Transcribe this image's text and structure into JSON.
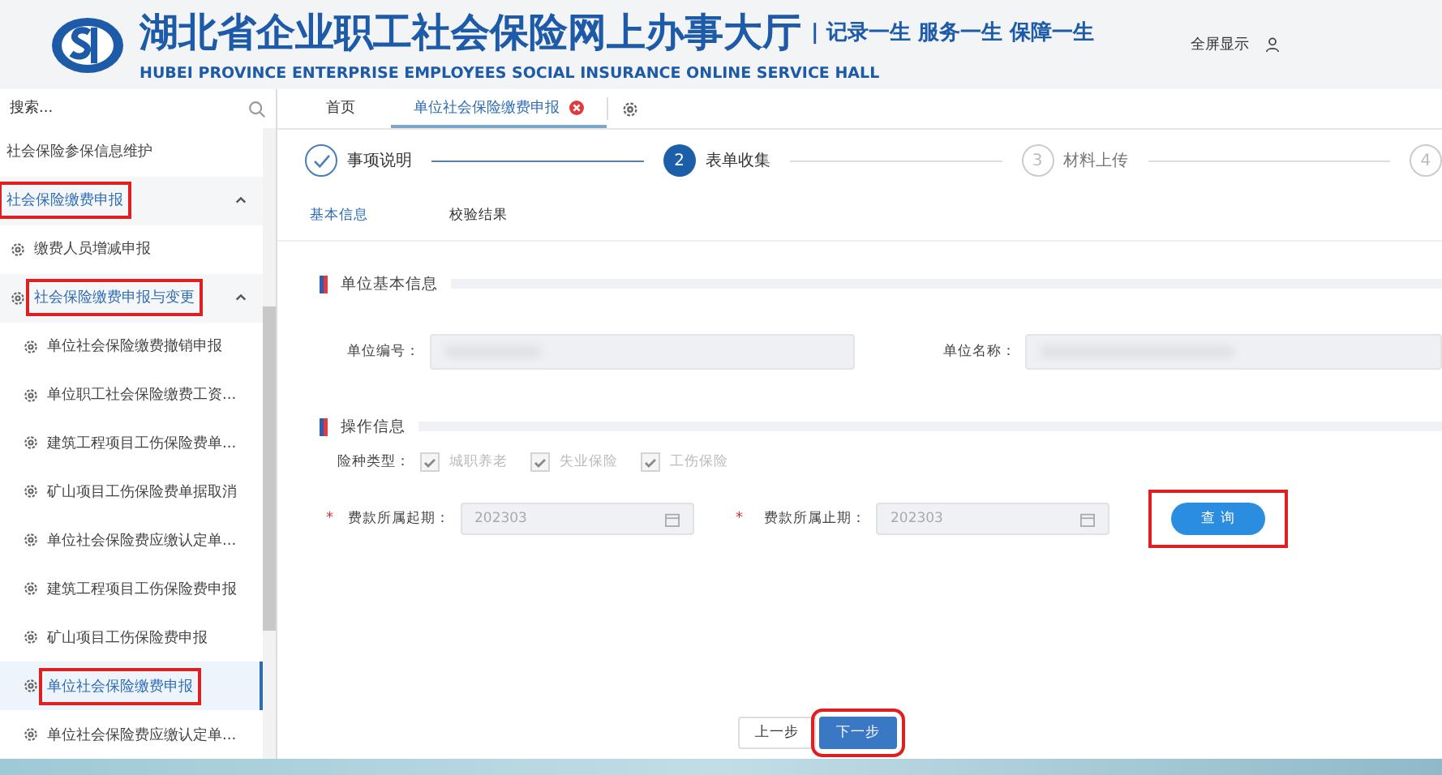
{
  "header": {
    "title": "湖北省企业职工社会保险网上办事大厅",
    "subtitle": "HUBEI PROVINCE ENTERPRISE EMPLOYEES SOCIAL INSURANCE ONLINE SERVICE HALL",
    "slogan": "| 记录一生  服务一生  保障一生",
    "fullscreen": "全屏显示"
  },
  "sidebar": {
    "search": {
      "placeholder": "搜索..."
    },
    "items": [
      {
        "label": "社会保险参保信息维护",
        "highlighted": false,
        "selected": false
      },
      {
        "label": "社会保险缴费申报",
        "expanded": true,
        "highlighted": true,
        "selected": false,
        "children": [
          {
            "label": "缴费人员增减申报",
            "highlighted": false,
            "selected": false
          },
          {
            "label": "社会保险缴费申报与变更",
            "expanded": true,
            "highlighted": true,
            "selected": false,
            "children": [
              {
                "label": "单位社会保险缴费撤销申报",
                "highlighted": false,
                "selected": false
              },
              {
                "label": "单位职工社会保险缴费工资...",
                "highlighted": false,
                "selected": false
              },
              {
                "label": "建筑工程项目工伤保险费单...",
                "highlighted": false,
                "selected": false
              },
              {
                "label": "矿山项目工伤保险费单据取消",
                "highlighted": false,
                "selected": false
              },
              {
                "label": "单位社会保险费应缴认定单...",
                "highlighted": false,
                "selected": false
              },
              {
                "label": "建筑工程项目工伤保险费申报",
                "highlighted": false,
                "selected": false
              },
              {
                "label": "矿山项目工伤保险费申报",
                "highlighted": false,
                "selected": false
              },
              {
                "label": "单位社会保险缴费申报",
                "highlighted": true,
                "selected": true
              },
              {
                "label": "单位社会保险费应缴认定单...",
                "highlighted": false,
                "selected": false
              }
            ]
          }
        ]
      }
    ]
  },
  "tabs": [
    {
      "label": "首页",
      "selected": false,
      "closable": false
    },
    {
      "label": "单位社会保险缴费申报",
      "selected": true,
      "closable": true
    }
  ],
  "steps": [
    {
      "label": "事项说明",
      "completed": true,
      "selected": false
    },
    {
      "number": "2",
      "label": "表单收集",
      "completed": false,
      "selected": true
    },
    {
      "number": "3",
      "label": "材料上传",
      "completed": false,
      "selected": false
    },
    {
      "number": "4",
      "completed": false,
      "selected": false
    }
  ],
  "subtabs": [
    {
      "label": "基本信息",
      "selected": true
    },
    {
      "label": "校验结果",
      "selected": false
    }
  ],
  "unit_section": {
    "title": "单位基本信息",
    "fields": [
      {
        "label": "单位编号："
      },
      {
        "label": "单位名称："
      }
    ]
  },
  "operation_section": {
    "title": "操作信息",
    "insurance_label": "险种类型：",
    "insurance_types": [
      {
        "label": "城职养老",
        "checked": true
      },
      {
        "label": "失业保险",
        "checked": true
      },
      {
        "label": "工伤保险",
        "checked": true
      }
    ],
    "dates": [
      {
        "marker": "*",
        "label": "费款所属起期：",
        "value": "202303"
      },
      {
        "marker": "*",
        "label": "费款所属止期：",
        "value": "202303"
      }
    ],
    "query_button": {
      "label": "查 询",
      "highlighted": true
    }
  },
  "footer": {
    "prev": {
      "label": "上一步",
      "highlighted": false
    },
    "next": {
      "label": "下一步",
      "highlighted": true
    }
  }
}
